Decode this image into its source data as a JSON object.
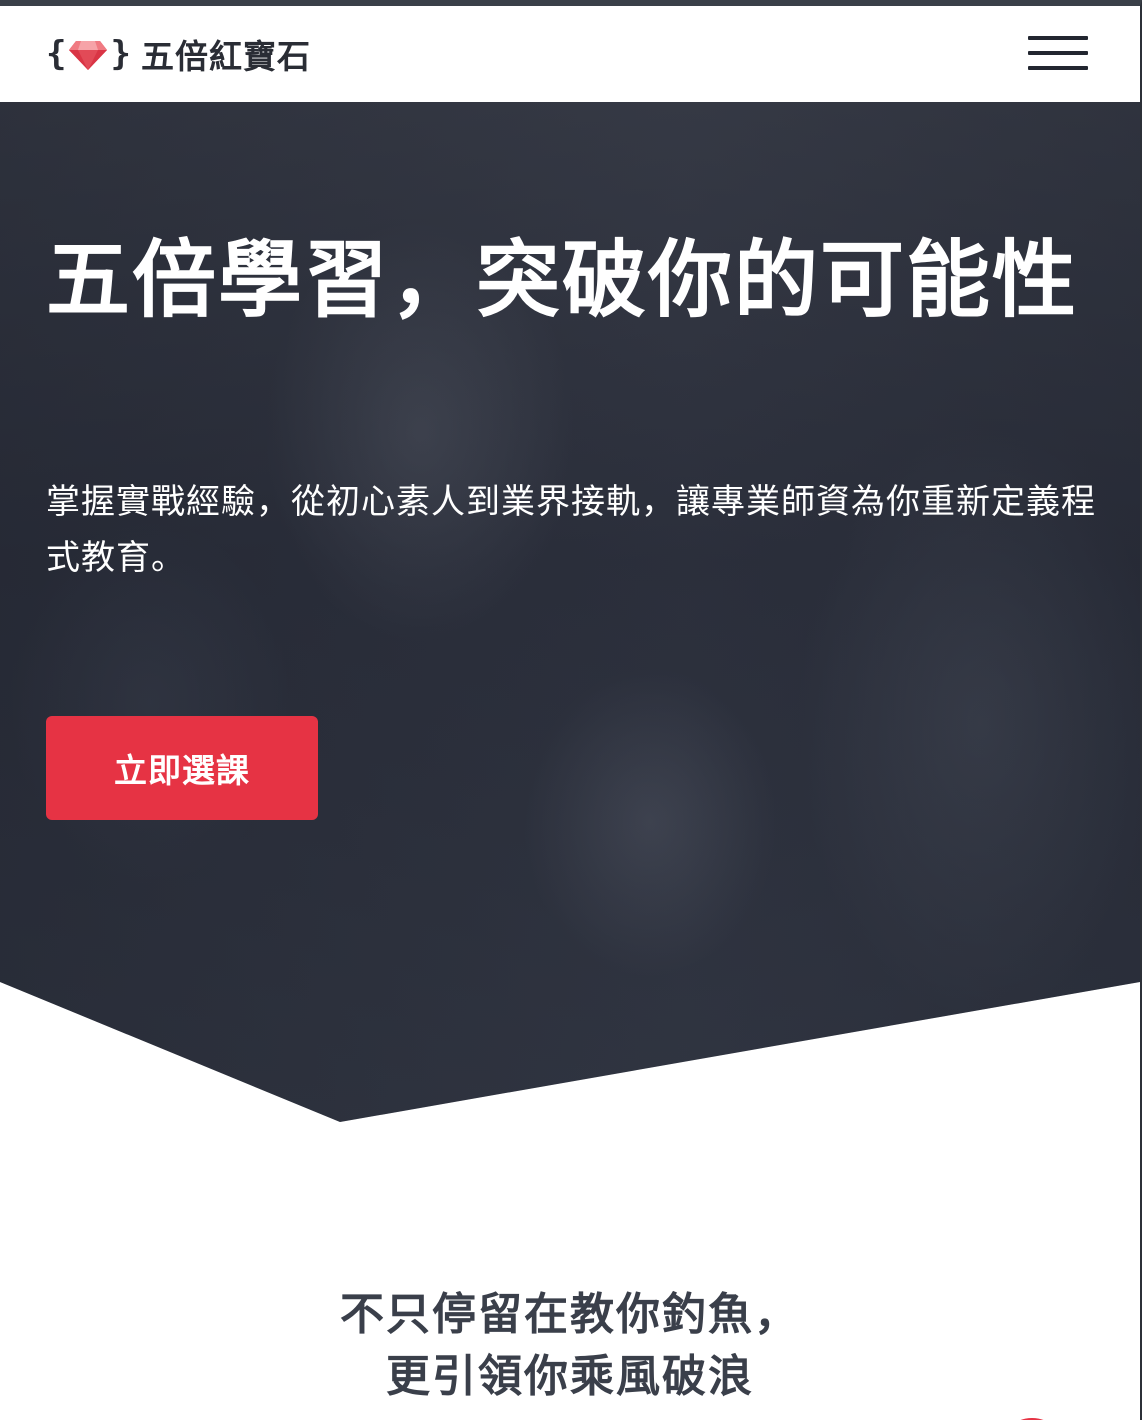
{
  "header": {
    "logo_left_brace": "{",
    "logo_right_brace": "}",
    "logo_text": "五倍紅寶石",
    "logo_icon": "ruby-gem-icon",
    "menu_icon": "hamburger-menu-icon"
  },
  "hero": {
    "title": "五倍學習，突破你的可能性",
    "subtitle": "掌握實戰經驗，從初心素人到業界接軌，讓專業師資為你重新定義程式教育。",
    "cta_label": "立即選課"
  },
  "intro": {
    "heading_line1": "不只停留在教你釣魚，",
    "heading_line2": "更引領你乘風破浪"
  },
  "colors": {
    "accent": "#e63344",
    "hero_bg": "#2f3340",
    "text_dark": "#2a2d35",
    "heading_gray": "#3a3f4a"
  }
}
